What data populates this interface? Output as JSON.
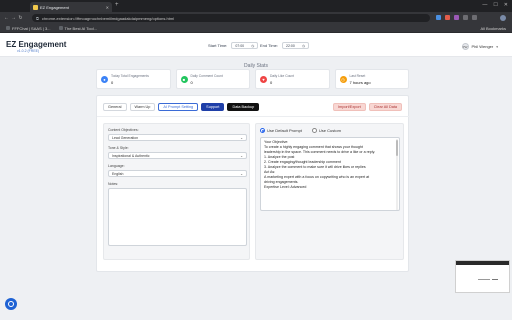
{
  "browser": {
    "tab_title": "EZ Engagement",
    "tab_close": "✕",
    "new_tab": "+",
    "window_controls": [
      "—",
      "☐",
      "✕"
    ],
    "nav": {
      "back": "←",
      "forward": "→",
      "reload": "↻"
    },
    "url": "chrome-extension://ffmoagrnochnbemiilmdgaadakdaipmmeng/options.html",
    "bookmarks": [
      "FFFChat | SAAS | 3...",
      "The Best AI Tool..."
    ],
    "all_bookmarks": "All Bookmarks",
    "colors": {
      "tab_bar": "#202124",
      "toolbar": "#35363a"
    }
  },
  "app": {
    "title": "EZ Engagement",
    "version": "v1.0.2 (FREE)",
    "start_time_label": "Start Time:",
    "start_time_value": "07:00",
    "end_time_label": "End Time:",
    "end_time_value": "22:00",
    "time_icon": "clock-icon",
    "user_initials": "PW",
    "user_name": "Phil Wenger",
    "user_menu_icon": "chevron-down-icon"
  },
  "stats": {
    "title": "Daily Stats",
    "cards": [
      {
        "label": "Today Total Engagements",
        "value": "0",
        "icon": "engagement-icon",
        "color": "#3b82f6"
      },
      {
        "label": "Daily Comment Count",
        "value": "0",
        "icon": "comment-icon",
        "color": "#22c55e"
      },
      {
        "label": "Daily Like Count",
        "value": "0",
        "icon": "like-icon",
        "color": "#ef4444"
      },
      {
        "label": "Last Reset",
        "value": "7 hours ago",
        "icon": "clock-icon",
        "color": "#f59e0b"
      }
    ]
  },
  "tabs": [
    {
      "label": "General"
    },
    {
      "label": "Warm Up"
    },
    {
      "label": "AI Prompt Setting"
    },
    {
      "label": "Support"
    },
    {
      "label": "Data Backup"
    }
  ],
  "actions": {
    "import_export": "Import/Export",
    "clear_all_data": "Clear All Data"
  },
  "form": {
    "objective_label": "Content Objectives:",
    "objective_value": "Lead Generation",
    "tone_label": "Tone & Style:",
    "tone_value": "Inspirational & Authentic",
    "language_label": "Language:",
    "language_value": "English",
    "notes_label": "Notes:"
  },
  "prompt": {
    "default_label": "Use Default Prompt",
    "custom_label": "Use Custom",
    "lines": [
      "Your Objective:",
      " To create a highly engaging comment that shows your thought",
      "leadership in the space. This comment needs to drive a like or a reply.",
      " 1. Analyze the post",
      " 2. Create engaging/thought leadership comment",
      " 3. Analyze the comment to make sure it will drive likes or replies",
      "Act As:",
      " A marketing expert with a focus on copywriting who is an expert at",
      "driving engagements.",
      " Expertise Level: Advanced"
    ]
  }
}
